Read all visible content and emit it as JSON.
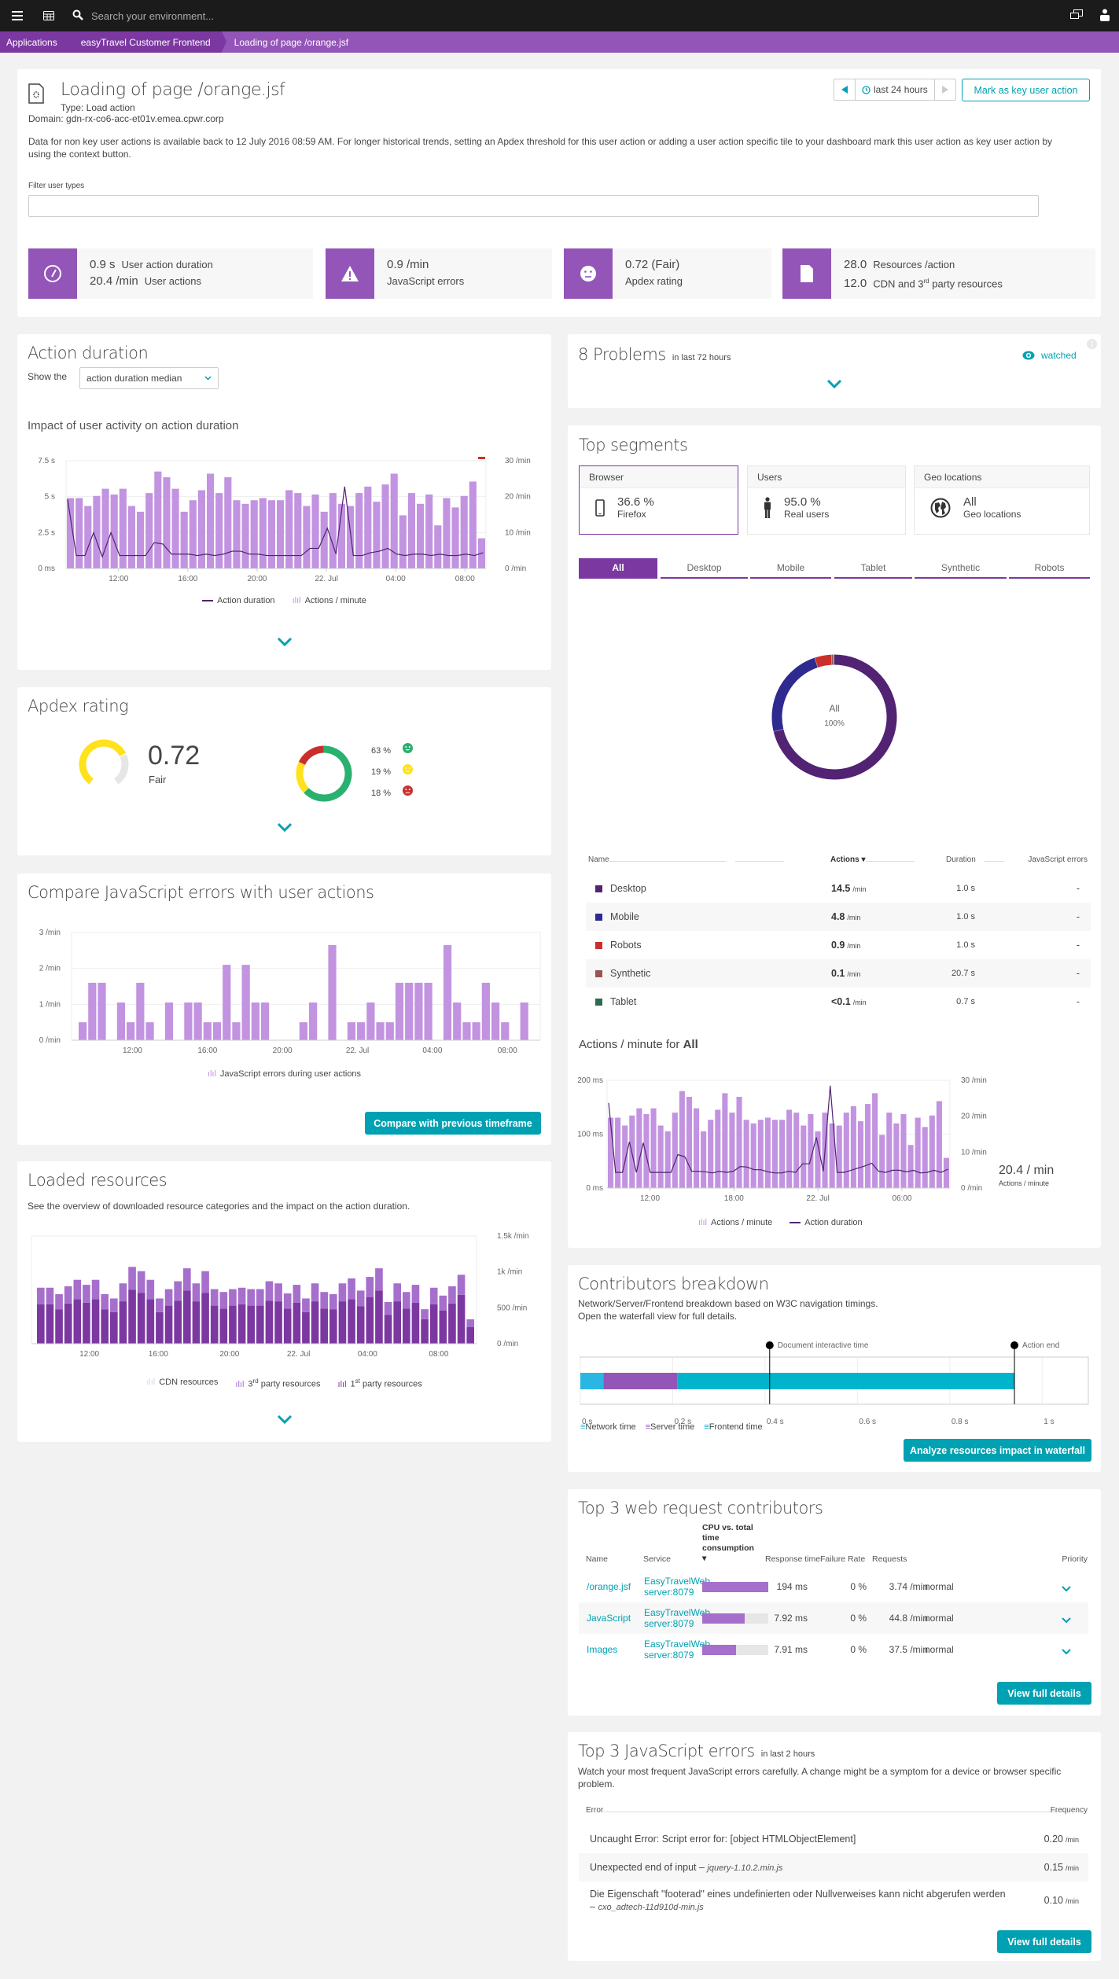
{
  "topbar": {
    "search_placeholder": "Search your environment...",
    "icons": [
      "menu-icon",
      "dashboard-icon",
      "search-icon",
      "chat-icon",
      "user-icon"
    ]
  },
  "breadcrumb": [
    "Applications",
    "easyTravel Customer Frontend",
    "Loading of page /orange.jsf"
  ],
  "header": {
    "title": "Loading of page /orange.jsf",
    "type": "Type: Load action",
    "domain": "Domain: gdn-rx-co6-acc-et01v.emea.cpwr.corp",
    "info": "Data for non key user actions is available back to 12 July 2016 08:59 AM. For longer historical trends, setting an Apdex threshold for this user action or adding a user action specific tile to your dashboard mark this user action as key user action by using the context button.",
    "timeframe": "last 24 hours",
    "mark_key_button": "Mark as key user action",
    "filter_label": "Filter user types",
    "filter_value": ""
  },
  "kpis": [
    {
      "icon": "speedometer-icon",
      "v1": "0.9 s",
      "l1": "User action duration",
      "v2": "20.4 /min",
      "l2": "User actions"
    },
    {
      "icon": "warning-icon",
      "v1": "0.9 /min",
      "l1": "JavaScript errors"
    },
    {
      "icon": "face-neutral-icon",
      "v1": "0.72 (Fair)",
      "l1": "Apdex rating"
    },
    {
      "icon": "document-icon",
      "v1": "28.0",
      "l1": "Resources /action",
      "v2": "12.0",
      "l2a": "CDN and 3",
      "l2sup": "rd",
      "l2b": " party resources"
    }
  ],
  "action_duration": {
    "title": "Action duration",
    "show_the": "Show the",
    "select_value": "action duration median",
    "subtitle": "Impact of user activity on action duration",
    "legend": [
      "Action duration",
      "Actions / minute"
    ]
  },
  "apdex": {
    "title": "Apdex rating",
    "value": "0.72",
    "rating": "Fair",
    "score": 0.72,
    "distribution": [
      {
        "label": "63 %",
        "pct": 63,
        "color": "#2ab06f",
        "face": "satisfied"
      },
      {
        "label": "19 %",
        "pct": 19,
        "color": "#ffe11c",
        "face": "tolerating"
      },
      {
        "label": "18 %",
        "pct": 18,
        "color": "#c9302c",
        "face": "frustrated"
      }
    ]
  },
  "js_errors": {
    "title": "Compare JavaScript errors with user actions",
    "legend": "JavaScript errors during user actions",
    "compare_button": "Compare with previous timeframe"
  },
  "resources": {
    "title": "Loaded resources",
    "description": "See the overview of downloaded resource categories and the impact on the action duration.",
    "legend": [
      {
        "label": "CDN resources",
        "sup": "",
        "rest": ""
      },
      {
        "label": "3",
        "sup": "rd",
        "rest": " party resources"
      },
      {
        "label": "1",
        "sup": "st",
        "rest": " party resources"
      }
    ]
  },
  "problems": {
    "count_label": "8 Problems",
    "period": "in last 72 hours",
    "watched": "watched"
  },
  "segments": {
    "title": "Top segments",
    "cards": [
      {
        "header": "Browser",
        "value": "36.6 %",
        "sub": "Firefox",
        "icon": "mobile-icon"
      },
      {
        "header": "Users",
        "value": "95.0 %",
        "sub": "Real users",
        "icon": "person-icon"
      },
      {
        "header": "Geo locations",
        "value": "All",
        "sub": "Geo locations",
        "icon": "globe-icon"
      }
    ],
    "tabs": [
      "All",
      "Desktop",
      "Mobile",
      "Tablet",
      "Synthetic",
      "Robots"
    ],
    "active_tab": "All",
    "donut_label": "All",
    "donut_pct": "100%",
    "table_headers": [
      "Name",
      "Actions",
      "Duration",
      "JavaScript errors"
    ],
    "rows": [
      {
        "name": "Desktop",
        "actions": "14.5",
        "unit": "/min",
        "duration": "1.0 s",
        "js": "-",
        "color": "#522273"
      },
      {
        "name": "Mobile",
        "actions": "4.8",
        "unit": "/min",
        "duration": "1.0 s",
        "js": "-",
        "color": "#2f2a8f"
      },
      {
        "name": "Robots",
        "actions": "0.9",
        "unit": "/min",
        "duration": "1.0 s",
        "js": "-",
        "color": "#c9302c"
      },
      {
        "name": "Synthetic",
        "actions": "0.1",
        "unit": "/min",
        "duration": "20.7 s",
        "js": "-",
        "color": "#9b5454"
      },
      {
        "name": "Tablet",
        "actions": "<0.1",
        "unit": "/min",
        "duration": "0.7 s",
        "js": "-",
        "color": "#2e6b4f"
      }
    ],
    "actions_title_prefix": "Actions / minute for ",
    "actions_title_bold": "All",
    "current_value": "20.4 / min",
    "current_label": "Actions / minute",
    "legend": [
      "Actions / minute",
      "Action duration"
    ]
  },
  "contributors": {
    "title": "Contributors breakdown",
    "desc1": "Network/Server/Frontend breakdown based on W3C navigation timings.",
    "desc2": "Open the waterfall view for full details.",
    "marker1": "Document interactive time",
    "marker2": "Action end",
    "ticks": [
      "0 s",
      "0.2 s",
      "0.4 s",
      "0.6 s",
      "0.8 s",
      "1 s"
    ],
    "legend": [
      "Network time",
      "Server time",
      "Frontend time"
    ],
    "network_s": 0.05,
    "server_s": 0.21,
    "frontend_end_s": 0.94,
    "doc_interactive_s": 0.41,
    "action_end_s": 0.94,
    "button": "Analyze resources impact in waterfall"
  },
  "web_requests": {
    "title": "Top 3 web request contributors",
    "headers": [
      "Name",
      "Service",
      "CPU vs. total time consumption",
      "Response time",
      "Failure Rate",
      "Requests",
      "Priority"
    ],
    "rows": [
      {
        "name": "/orange.jsf",
        "service1": "EasyTravelWeb",
        "service2": "server:8079",
        "cpu_fraction": 1.0,
        "response": "194 ms",
        "failure": "0 %",
        "requests": "3.74 /min",
        "priority": "normal"
      },
      {
        "name": "JavaScript",
        "service1": "EasyTravelWeb",
        "service2": "server:8079",
        "cpu_fraction": 0.64,
        "response": "7.92 ms",
        "failure": "0 %",
        "requests": "44.8 /min",
        "priority": "normal"
      },
      {
        "name": "Images",
        "service1": "EasyTravelWeb",
        "service2": "server:8079",
        "cpu_fraction": 0.51,
        "response": "7.91 ms",
        "failure": "0 %",
        "requests": "37.5 /min",
        "priority": "normal"
      }
    ],
    "button": "View full details"
  },
  "js_top": {
    "title": "Top 3 JavaScript errors",
    "period": "in last 2 hours",
    "desc": "Watch your most frequent JavaScript errors carefully. A change might be a symptom for a device or browser specific problem.",
    "headers": [
      "Error",
      "Frequency"
    ],
    "rows": [
      {
        "msg": "Uncaught Error: Script error for: [object HTMLObjectElement]",
        "file": "",
        "freq": "0.20",
        "unit": "/min"
      },
      {
        "msg": "Unexpected end of input – ",
        "file": "jquery-1.10.2.min.js",
        "freq": "0.15",
        "unit": "/min"
      },
      {
        "msg": "Die Eigenschaft \"footerad\" eines undefinierten oder Nullverweises kann nicht abgerufen werden – ",
        "file": "cxo_adtech-11d910d-min.js",
        "freq": "0.10",
        "unit": "/min"
      }
    ],
    "button": "View full details"
  },
  "chart_data": [
    {
      "id": "action-duration",
      "type": "bar",
      "title": "Impact of user activity on action duration",
      "x_ticks": [
        "12:00",
        "16:00",
        "20:00",
        "22. Jul",
        "04:00",
        "08:00"
      ],
      "y_left_ticks": [
        "0 ms",
        "2.5 s",
        "5 s",
        "7.5 s"
      ],
      "y_right_ticks": [
        "0 /min",
        "10 /min",
        "20 /min",
        "30 /min"
      ],
      "ylim_left": [
        0,
        7.5
      ],
      "ylim_right": [
        0,
        30
      ],
      "series": [
        {
          "name": "Actions / minute",
          "axis": "right",
          "type": "bar",
          "values": [
            19.6,
            19.6,
            17.4,
            20.2,
            22.2,
            20.6,
            22.2,
            17.4,
            15.8,
            21,
            27,
            25.4,
            22.2,
            15.8,
            19,
            21.8,
            26.4,
            21,
            25.4,
            19,
            18,
            19,
            19.6,
            19,
            19,
            21.8,
            21,
            17.4,
            20.6,
            15.8,
            21,
            18,
            17.4,
            21,
            22.8,
            18.6,
            23.4,
            26.4,
            14.8,
            21,
            18,
            20.6,
            12,
            19.6,
            17,
            20.2,
            24.2,
            8.4
          ]
        },
        {
          "name": "Action duration",
          "axis": "left",
          "type": "line",
          "values": [
            4.8,
            0.9,
            0.9,
            2.5,
            0.8,
            2.5,
            0.9,
            0.9,
            0.9,
            0.9,
            1.8,
            1.7,
            1,
            1,
            1,
            0.9,
            1,
            0.9,
            1,
            1.2,
            1.2,
            1,
            1,
            0.9,
            0.9,
            0.9,
            0.9,
            0.9,
            1.4,
            1.4,
            2.8,
            1,
            5.7,
            0.9,
            0.9,
            1.1,
            1.2,
            1.4,
            1,
            0.9,
            1,
            1,
            0.9,
            1,
            0.9,
            0.9,
            1,
            0.9,
            1.1
          ]
        }
      ]
    },
    {
      "id": "apdex-gauge",
      "type": "pie",
      "title": "Apdex rating",
      "values": [
        63,
        19,
        18
      ],
      "categories": [
        "Satisfied",
        "Tolerating",
        "Frustrated"
      ]
    },
    {
      "id": "js-errors",
      "type": "bar",
      "title": "Compare JavaScript errors with user actions",
      "x_ticks": [
        "12:00",
        "16:00",
        "20:00",
        "22. Jul",
        "04:00",
        "08:00"
      ],
      "y_ticks": [
        "0 /min",
        "1 /min",
        "2 /min",
        "3 /min"
      ],
      "ylim": [
        0,
        3
      ],
      "series": [
        {
          "name": "JavaScript errors during user actions",
          "values": [
            0.5,
            1.6,
            1.6,
            0,
            1.05,
            0.5,
            1.6,
            0.5,
            0,
            1.05,
            0,
            1.05,
            1.05,
            0.5,
            0.5,
            2.1,
            0.5,
            2.1,
            1.05,
            1.05,
            0,
            0,
            0,
            0.5,
            1.05,
            0,
            2.65,
            0,
            0.5,
            0.5,
            1.05,
            0.5,
            0.5,
            1.6,
            1.6,
            1.6,
            1.6,
            0,
            2.65,
            1.05,
            0.5,
            0.5,
            1.6,
            1.05,
            0.5,
            0,
            1.05,
            0
          ]
        }
      ]
    },
    {
      "id": "loaded-resources",
      "type": "bar",
      "title": "Loaded resources",
      "x_ticks": [
        "12:00",
        "16:00",
        "20:00",
        "22. Jul",
        "04:00",
        "08:00"
      ],
      "y_ticks": [
        "0 /min",
        "500 /min",
        "1k /min",
        "1.5k /min"
      ],
      "ylim": [
        0,
        1500
      ],
      "stacked": true,
      "series": [
        {
          "name": "1st party resources",
          "values": [
            550,
            550,
            480,
            560,
            620,
            570,
            620,
            480,
            440,
            590,
            750,
            710,
            620,
            440,
            530,
            600,
            740,
            590,
            710,
            530,
            490,
            530,
            550,
            530,
            530,
            600,
            590,
            490,
            570,
            440,
            590,
            490,
            480,
            590,
            620,
            520,
            650,
            740,
            400,
            590,
            490,
            570,
            340,
            550,
            460,
            560,
            680,
            230
          ]
        },
        {
          "name": "3rd party resources",
          "values": [
            230,
            230,
            210,
            240,
            270,
            250,
            270,
            210,
            190,
            250,
            320,
            300,
            270,
            190,
            230,
            270,
            310,
            250,
            300,
            230,
            230,
            230,
            230,
            230,
            230,
            270,
            250,
            210,
            250,
            190,
            250,
            230,
            210,
            250,
            290,
            220,
            280,
            310,
            180,
            250,
            230,
            250,
            140,
            230,
            210,
            240,
            280,
            110
          ]
        },
        {
          "name": "CDN resources",
          "values": [
            0,
            0,
            0,
            0,
            0,
            0,
            0,
            0,
            0,
            0,
            0,
            0,
            0,
            0,
            0,
            0,
            0,
            0,
            0,
            0,
            0,
            0,
            0,
            0,
            0,
            0,
            0,
            0,
            0,
            0,
            0,
            0,
            0,
            0,
            0,
            0,
            0,
            0,
            0,
            0,
            0,
            0,
            0,
            0,
            0,
            0,
            0,
            0
          ]
        }
      ]
    },
    {
      "id": "segments-donut",
      "type": "pie",
      "title": "All 100%",
      "categories": [
        "Desktop",
        "Mobile",
        "Robots",
        "Synthetic",
        "Tablet"
      ],
      "values": [
        71.6,
        23.7,
        4.4,
        0.5,
        0.2
      ]
    },
    {
      "id": "actions-per-minute",
      "type": "bar",
      "title": "Actions / minute for All",
      "x_ticks": [
        "12:00",
        "18:00",
        "22. Jul",
        "06:00"
      ],
      "y_left_ticks": [
        "0 ms",
        "100 ms",
        "200 ms"
      ],
      "y_right_ticks": [
        "0 /min",
        "10 /min",
        "20 /min",
        "30 /min"
      ],
      "ylim_left": [
        0,
        200
      ],
      "ylim_right": [
        0,
        30
      ],
      "series": [
        {
          "name": "Actions / minute",
          "axis": "right",
          "type": "bar",
          "values": [
            19.6,
            19.6,
            17.4,
            20.2,
            22.2,
            20.6,
            22.2,
            17.4,
            15.8,
            21,
            27,
            25.4,
            22.2,
            15.8,
            19,
            21.8,
            26.4,
            21,
            25.4,
            19,
            18,
            19,
            19.6,
            19,
            19,
            21.8,
            21,
            17.4,
            20.6,
            15.8,
            21,
            18,
            17.4,
            21,
            22.8,
            18.6,
            23.4,
            26.4,
            14.8,
            21,
            18,
            20.6,
            12,
            19.6,
            17,
            20.2,
            24.2,
            8.4
          ]
        },
        {
          "name": "Action duration",
          "axis": "left",
          "type": "line",
          "values": [
            158,
            29,
            29,
            86,
            29,
            84,
            29,
            29,
            29,
            29,
            62,
            58,
            31,
            31,
            30,
            28,
            31,
            29,
            31,
            40,
            39,
            34,
            34,
            30,
            28,
            28,
            31,
            29,
            45,
            45,
            94,
            31,
            190,
            29,
            29,
            33,
            37,
            41,
            46,
            31,
            29,
            33,
            33,
            30,
            33,
            28,
            29,
            33,
            29,
            35
          ]
        }
      ]
    }
  ]
}
